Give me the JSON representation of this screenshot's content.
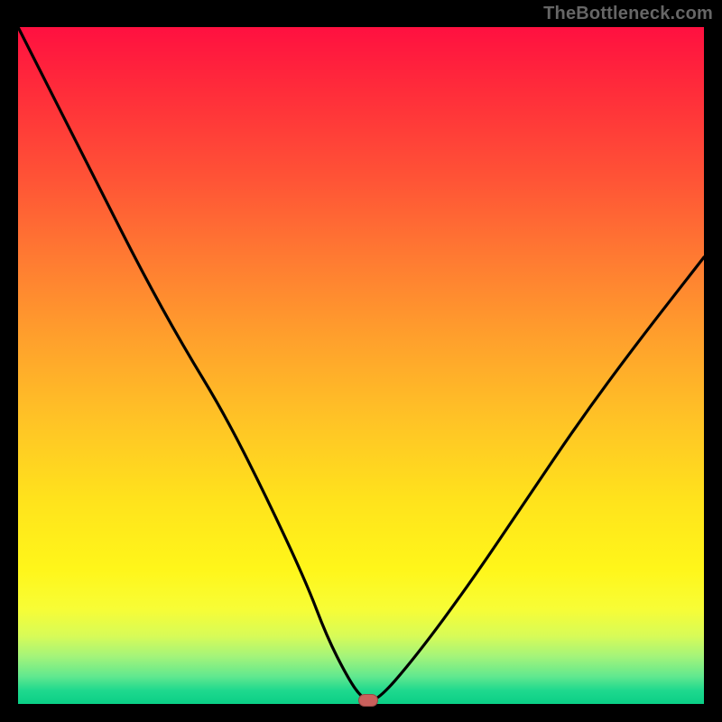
{
  "watermark": "TheBottleneck.com",
  "colors": {
    "gradient_top": "#ff1040",
    "gradient_bottom": "#0acf86",
    "curve_stroke": "#000000",
    "marker_fill": "#c9605c"
  },
  "chart_data": {
    "type": "line",
    "title": "",
    "xlabel": "",
    "ylabel": "",
    "xlim": [
      0,
      100
    ],
    "ylim": [
      0,
      100
    ],
    "grid": false,
    "legend": false,
    "series": [
      {
        "name": "bottleneck-curve",
        "x": [
          0,
          6,
          12,
          18,
          24,
          30,
          36,
          42,
          45,
          48,
          50,
          52,
          58,
          66,
          74,
          82,
          90,
          100
        ],
        "values": [
          100,
          88,
          76,
          64,
          53,
          43,
          31,
          18,
          10,
          4,
          1,
          0,
          7,
          18,
          30,
          42,
          53,
          66
        ]
      }
    ],
    "marker": {
      "x": 51,
      "y": 0.5
    }
  }
}
